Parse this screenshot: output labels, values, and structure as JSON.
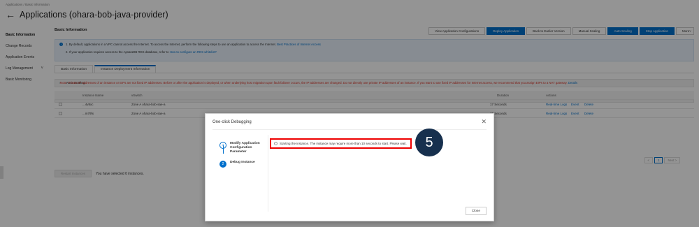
{
  "breadcrumb": {
    "items": [
      "Applications",
      "Basic Information"
    ],
    "separator": "/"
  },
  "header": {
    "back_icon": "arrow-left-icon",
    "title": "Applications (ohara-bob-java-provider)"
  },
  "sidebar": {
    "items": [
      {
        "label": "Basic Information",
        "active": true
      },
      {
        "label": "Change Records"
      },
      {
        "label": "Application Events"
      },
      {
        "label": "Log Management",
        "chevron": "˅"
      },
      {
        "label": "Basic Monitoring"
      }
    ]
  },
  "main": {
    "title": "Basic Information",
    "actions": [
      {
        "label": "View Application Configurations"
      },
      {
        "label": "Deploy Application",
        "primary": true
      },
      {
        "label": "Back to Earlier Version"
      },
      {
        "label": "Manual Scaling"
      },
      {
        "label": "Auto Scaling",
        "primary": true
      },
      {
        "label": "Stop Application",
        "primary": true
      },
      {
        "label": "More",
        "chevron": "˅"
      }
    ],
    "notice": {
      "line1": "1. By default, applications in a VPC cannot access the Internet. To access the Internet, perform the following steps to use an application to access the Internet.",
      "line1_link": "Best Practices of Internet Access",
      "line2": "2. If your application requires access to the ApsaraDB RDS database, refer to",
      "line2_link": "How to configure an RDS whitelist?"
    },
    "tabs": [
      {
        "label": "Basic Information"
      },
      {
        "label": "Instance Deployment Information",
        "active": true
      }
    ],
    "auto_scaling": {
      "label": "Auto Scaling"
    },
    "group": {
      "label": "Default Group",
      "status": "Status: 0 Running Instances"
    },
    "warning": "Note: Private IP addresses of an instance or EIPs are not fixed IP addresses. Before or after the application is deployed, or when underlying host migration upon fault failover occurs, the IP addresses are changed. Do not directly use private IP addresses of an instance. If you want to use fixed IP addresses for Internet access, we recommend that you assign EIPs to a NAT gateway.",
    "warning_link": "Details",
    "table": {
      "headers": {
        "name": "Instance Name",
        "vswitch": "vSwitch",
        "duration": "Duration",
        "actions": "Actions"
      },
      "rows": [
        {
          "name": "...4v8xc",
          "vswitch": "Zone A ohara-bob-sae-a",
          "duration": "17 Seconds",
          "actions": [
            "Real-time Logs",
            "Event",
            "Delete"
          ]
        },
        {
          "name": "...m79fx",
          "vswitch": "Zone A ohara-bob-sae-a",
          "duration": "15 Seconds",
          "actions": [
            "Real-time Logs",
            "Event",
            "Delete"
          ]
        }
      ]
    },
    "pager": {
      "prev": "<",
      "page": "1",
      "next": "Next >"
    },
    "batch": {
      "button": "Restart Instances",
      "selected_text": "You have selected 0 instances."
    }
  },
  "modal": {
    "title": "One-click Debugging",
    "close_icon": "close-icon",
    "steps": [
      {
        "label": "Modify Application Configuration Parameter",
        "state": "done",
        "mark": "✓"
      },
      {
        "label": "Debug Instance",
        "state": "current",
        "mark": "2"
      }
    ],
    "status_text": "Starting the instance. The instance may require more than 10 seconds to start. Please wait.",
    "close_button": "Close"
  },
  "annotation": {
    "number": "5"
  },
  "colors": {
    "primary": "#0070cc",
    "badge": "#17304e",
    "highlight": "#e00000",
    "warning": "#d93025"
  }
}
